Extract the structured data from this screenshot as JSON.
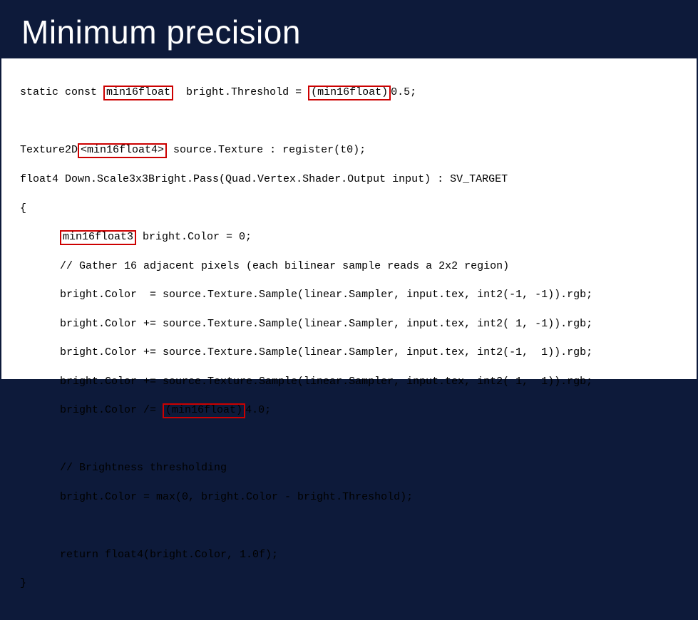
{
  "title": "Minimum precision",
  "code": {
    "l1a": "static const ",
    "l1_box": "min16float",
    "l1b": "  bright.Threshold = ",
    "l1_box2": "(min16float)",
    "l1c": "0.5;",
    "l2": "",
    "l3a": "Texture2D",
    "l3_box": "<min16float4>",
    "l3b": " source.Texture : register(t0);",
    "l4": "float4 Down.Scale3x3Bright.Pass(Quad.Vertex.Shader.Output input) : SV_TARGET",
    "l5": "{",
    "l6_box": "min16float3",
    "l6b": " bright.Color = 0;",
    "l7": "// Gather 16 adjacent pixels (each bilinear sample reads a 2x2 region)",
    "l8": "bright.Color  = source.Texture.Sample(linear.Sampler, input.tex, int2(-1, -1)).rgb;",
    "l9": "bright.Color += source.Texture.Sample(linear.Sampler, input.tex, int2( 1, -1)).rgb;",
    "l10": "bright.Color += source.Texture.Sample(linear.Sampler, input.tex, int2(-1,  1)).rgb;",
    "l11": "bright.Color += source.Texture.Sample(linear.Sampler, input.tex, int2( 1,  1)).rgb;",
    "l12a": "bright.Color /= ",
    "l12_box": "(min16float)",
    "l12b": "4.0;",
    "l13": "",
    "l14": "// Brightness thresholding",
    "l15": "bright.Color = max(0, bright.Color - bright.Threshold);",
    "l16": "",
    "l17": "return float4(bright.Color, 1.0f);",
    "l18": "}"
  }
}
